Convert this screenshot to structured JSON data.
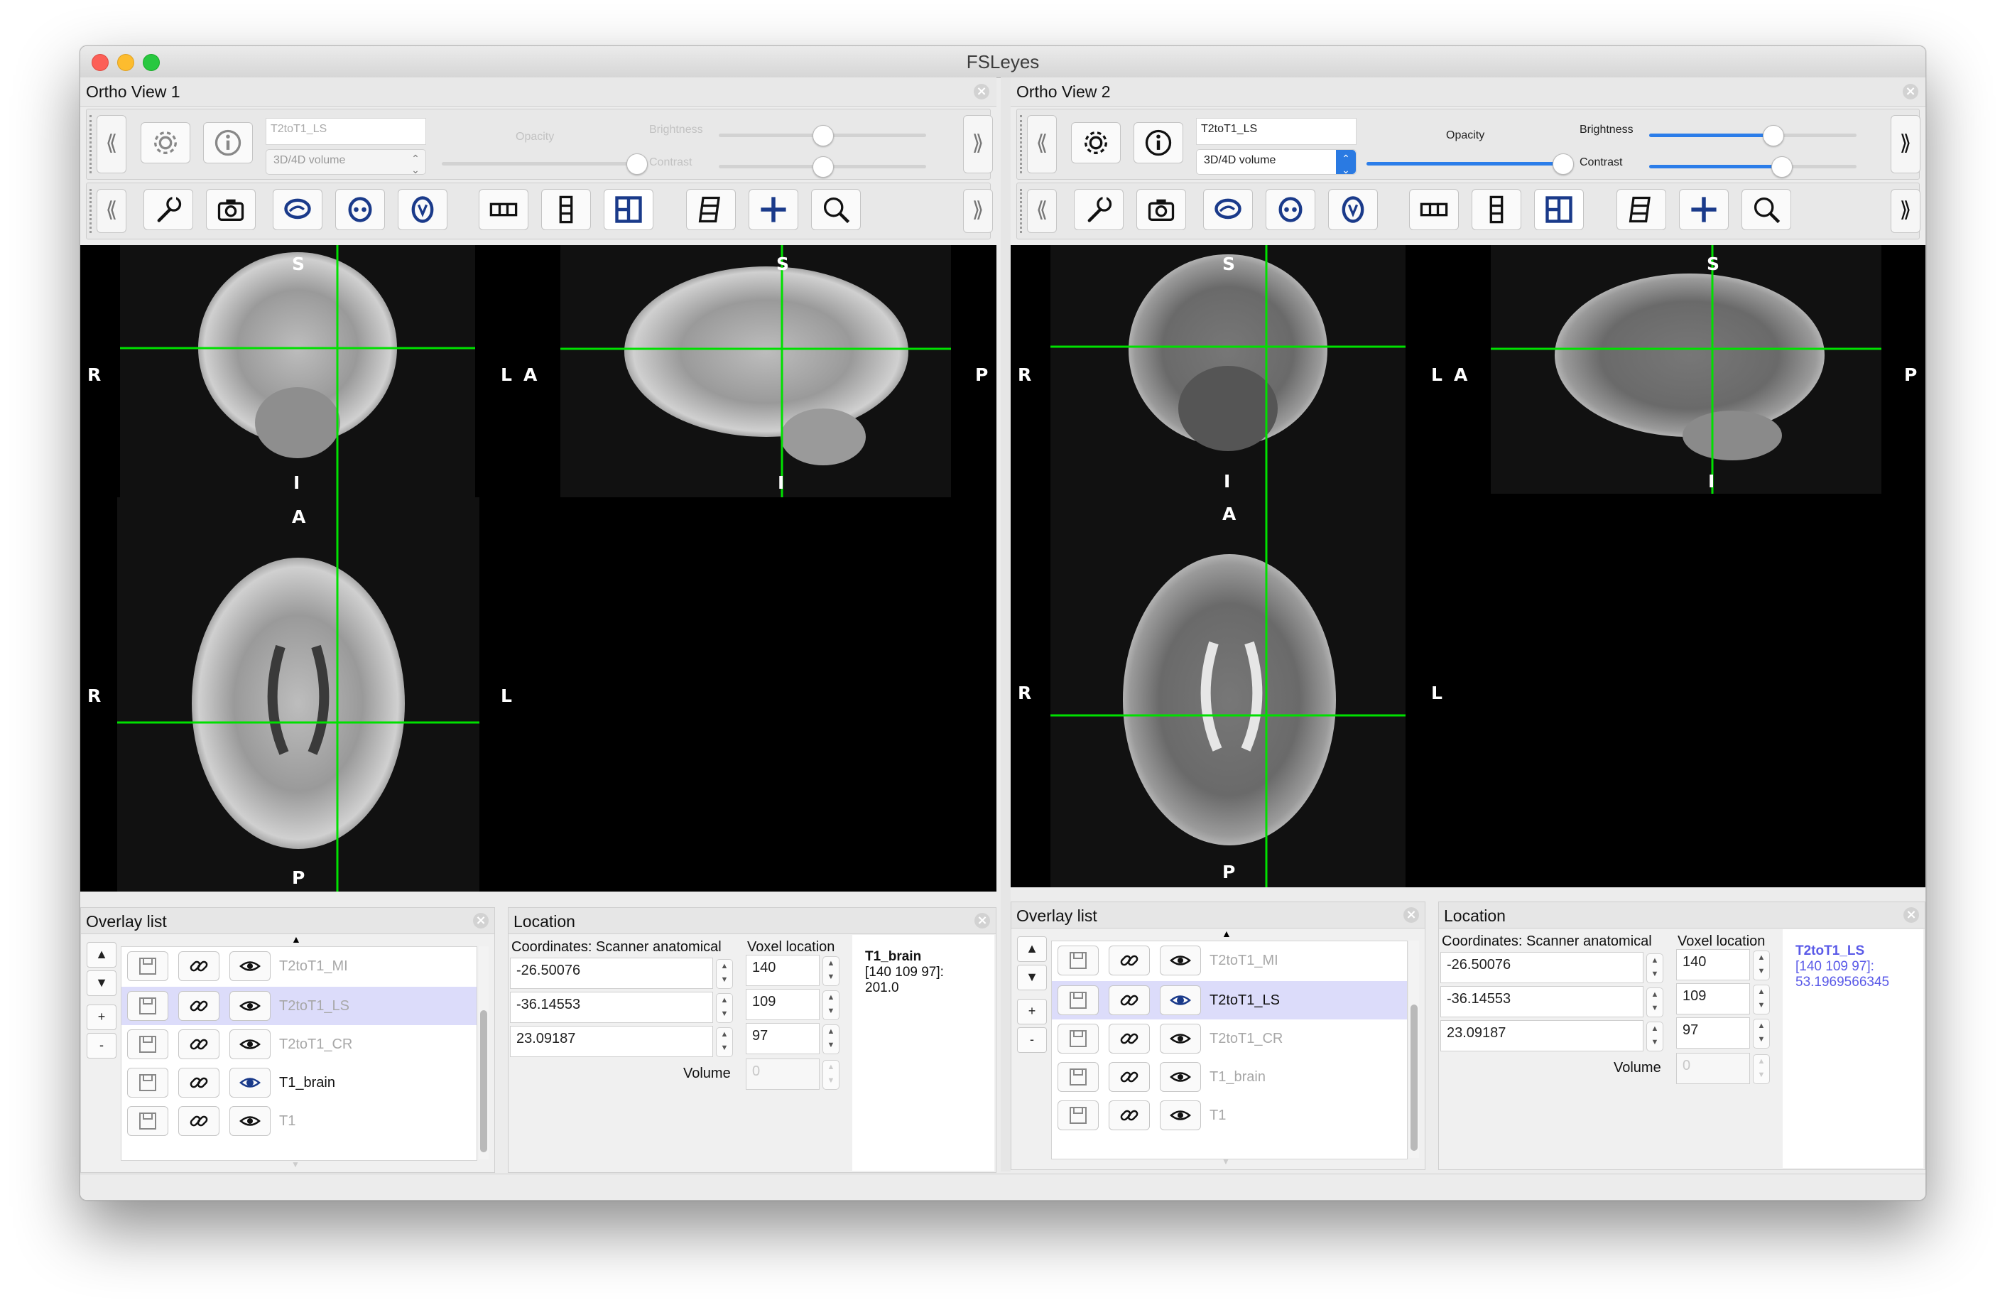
{
  "window": {
    "title": "FSLeyes"
  },
  "views": [
    {
      "title": "Ortho View 1",
      "toolbar": {
        "overlay_name": "T2toT1_LS",
        "overlay_type": "3D/4D volume",
        "opacity_label": "Opacity",
        "brightness_label": "Brightness",
        "contrast_label": "Contrast"
      },
      "orient": {
        "coronal": {
          "top": "S",
          "bottom": "I",
          "left": "R",
          "right": "L"
        },
        "sagittal": {
          "top": "S",
          "bottom": "I",
          "left": "A",
          "right": "P"
        },
        "axial": {
          "top": "A",
          "bottom": "P",
          "left": "R",
          "right": "L"
        }
      },
      "overlay_panel": {
        "title": "Overlay list",
        "items": [
          {
            "name": "T2toT1_MI"
          },
          {
            "name": "T2toT1_LS"
          },
          {
            "name": "T2toT1_CR"
          },
          {
            "name": "T1_brain"
          },
          {
            "name": "T1"
          }
        ]
      },
      "location_panel": {
        "title": "Location",
        "coords_label": "Coordinates: Scanner anatomical",
        "voxel_label": "Voxel location",
        "coords": [
          "-26.50076",
          "-36.14553",
          "23.09187"
        ],
        "voxels": [
          "140",
          "109",
          "97"
        ],
        "volume_label": "Volume",
        "volume_value": "0",
        "info_name": "T1_brain",
        "info_value_line1": "[140 109 97]:",
        "info_value_line2": "201.0"
      }
    },
    {
      "title": "Ortho View 2",
      "toolbar": {
        "overlay_name": "T2toT1_LS",
        "overlay_type": "3D/4D volume",
        "opacity_label": "Opacity",
        "brightness_label": "Brightness",
        "contrast_label": "Contrast"
      },
      "orient": {
        "coronal": {
          "top": "S",
          "bottom": "I",
          "left": "R",
          "right": "L"
        },
        "sagittal": {
          "top": "S",
          "bottom": "I",
          "left": "A",
          "right": "P"
        },
        "axial": {
          "top": "A",
          "bottom": "P",
          "left": "R",
          "right": "L"
        }
      },
      "overlay_panel": {
        "title": "Overlay list",
        "items": [
          {
            "name": "T2toT1_MI"
          },
          {
            "name": "T2toT1_LS"
          },
          {
            "name": "T2toT1_CR"
          },
          {
            "name": "T1_brain"
          },
          {
            "name": "T1"
          }
        ]
      },
      "location_panel": {
        "title": "Location",
        "coords_label": "Coordinates: Scanner anatomical",
        "voxel_label": "Voxel location",
        "coords": [
          "-26.50076",
          "-36.14553",
          "23.09187"
        ],
        "voxels": [
          "140",
          "109",
          "97"
        ],
        "volume_label": "Volume",
        "volume_value": "0",
        "info_name": "T2toT1_LS",
        "info_value_line1": "[140 109 97]:",
        "info_value_line2": "53.1969566345"
      }
    }
  ],
  "colors": {
    "crosshair": "#00e000",
    "accent": "#2b7de9",
    "selected_row": "#dcdcfa",
    "info_highlight": "#5a5ae8"
  }
}
